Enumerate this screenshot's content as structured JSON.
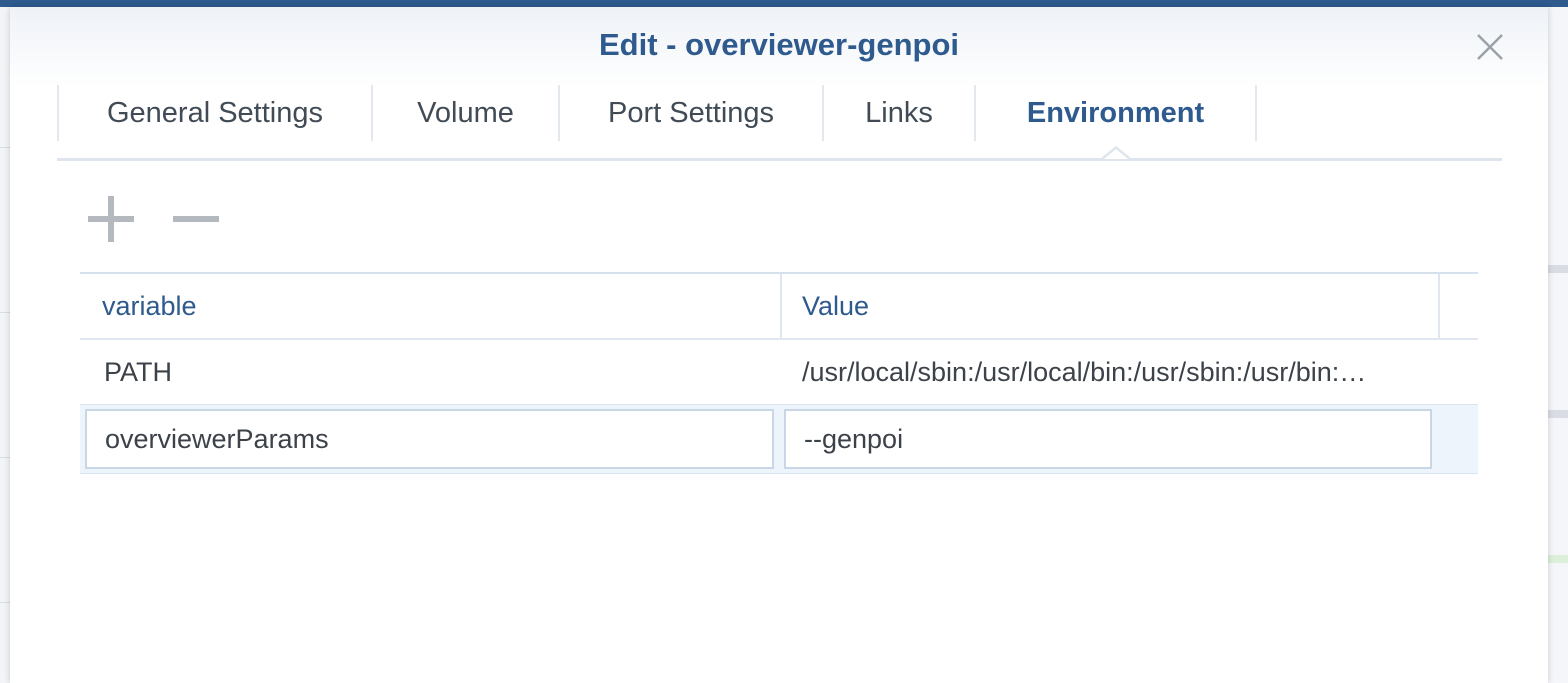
{
  "dialog": {
    "title": "Edit - overviewer-genpoi"
  },
  "tabs": [
    {
      "label": "General Settings",
      "active": false
    },
    {
      "label": "Volume",
      "active": false
    },
    {
      "label": "Port Settings",
      "active": false
    },
    {
      "label": "Links",
      "active": false
    },
    {
      "label": "Environment",
      "active": true
    }
  ],
  "toolbar": {
    "add_icon": "plus-icon",
    "remove_icon": "minus-icon"
  },
  "grid": {
    "columns": [
      "variable",
      "Value"
    ],
    "rows": [
      {
        "variable": "PATH",
        "value": "/usr/local/sbin:/usr/local/bin:/usr/sbin:/usr/bin:/sbin:/bin",
        "editing": false
      },
      {
        "variable": "overviewerParams",
        "value": "--genpoi",
        "editing": true
      }
    ]
  },
  "colors": {
    "accent": "#2e5a8e",
    "text": "#3c4249",
    "selected_row": "#eef4fb"
  }
}
